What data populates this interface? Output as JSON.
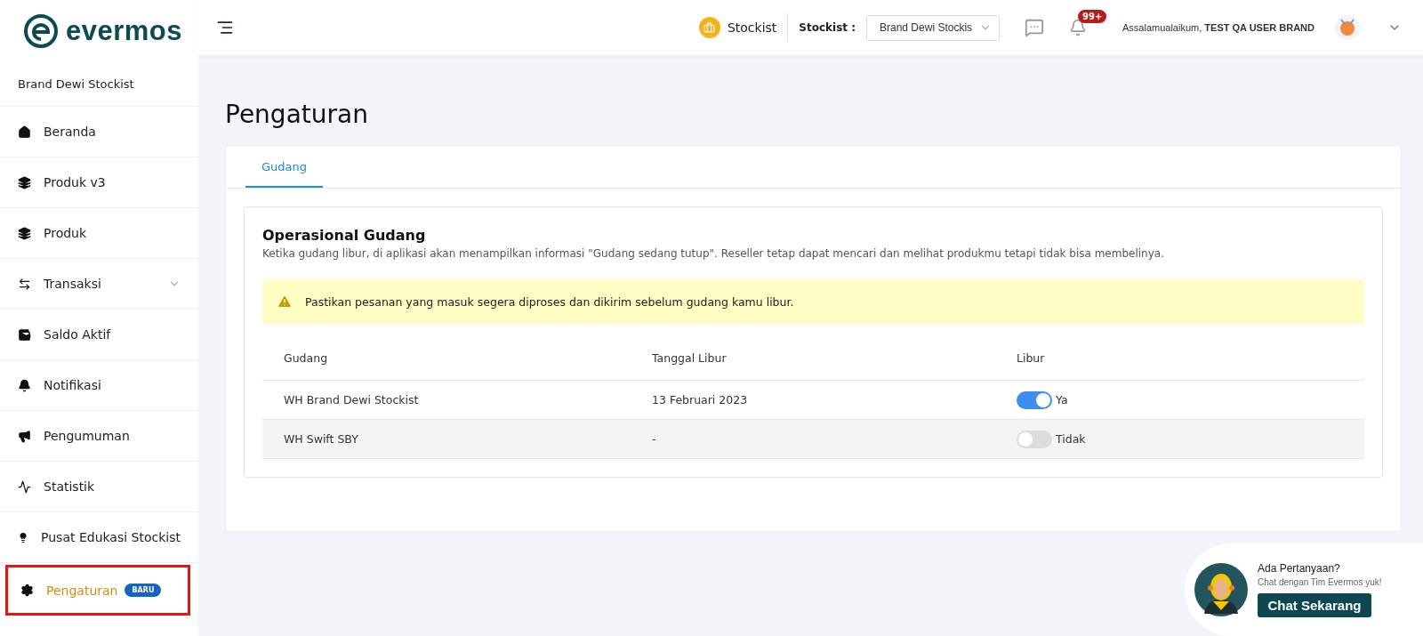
{
  "logo": {
    "text": "evermos"
  },
  "header": {
    "role_label": "Stockist",
    "stockist_label": "Stockist :",
    "stockist_select": "Brand Dewi Stockis",
    "notification_badge": "99+",
    "greeting": "Assalamualaikum,",
    "user_name": "TEST QA USER BRAND"
  },
  "sidebar": {
    "store_name": "Brand Dewi Stockist",
    "items": [
      {
        "label": "Beranda",
        "selected": false,
        "highlighted": false
      },
      {
        "label": "Produk v3",
        "selected": false,
        "highlighted": false
      },
      {
        "label": "Produk",
        "selected": false,
        "highlighted": false
      },
      {
        "label": "Transaksi",
        "selected": false,
        "highlighted": false,
        "expanded": false
      },
      {
        "label": "Saldo Aktif",
        "selected": false,
        "highlighted": false
      },
      {
        "label": "Notifikasi",
        "selected": false,
        "highlighted": false
      },
      {
        "label": "Pengumuman",
        "selected": false,
        "highlighted": false
      },
      {
        "label": "Statistik",
        "selected": false,
        "highlighted": false
      },
      {
        "label": "Pusat Edukasi Stockist",
        "selected": false,
        "highlighted": false
      },
      {
        "label": "Pengaturan",
        "selected": true,
        "highlighted": true,
        "badge": "BARU"
      }
    ]
  },
  "page_title": "Pengaturan",
  "tabs": [
    {
      "label": "Gudang",
      "selected": true
    }
  ],
  "section": {
    "title": "Operasional Gudang",
    "description": "Ketika gudang libur, di aplikasi akan menampilkan informasi \"Gudang sedang tutup\". Reseller tetap dapat mencari dan melihat produkmu tetapi tidak bisa membelinya.",
    "warning": "Pastikan pesanan yang masuk segera diproses dan dikirim sebelum gudang kamu libur."
  },
  "table": {
    "columns": [
      "Gudang",
      "Tanggal Libur",
      "Libur"
    ],
    "rows": [
      {
        "gudang": "WH Brand Dewi Stockist",
        "tanggal": "13 Februari 2023",
        "on": true,
        "status": "Ya"
      },
      {
        "gudang": "WH Swift SBY",
        "tanggal": "-",
        "on": false,
        "status": "Tidak"
      }
    ]
  },
  "chat_widget": {
    "title": "Ada Pertanyaan?",
    "subtitle": "Chat dengan Tim Evermos yuk!",
    "button": "Chat Sekarang"
  }
}
